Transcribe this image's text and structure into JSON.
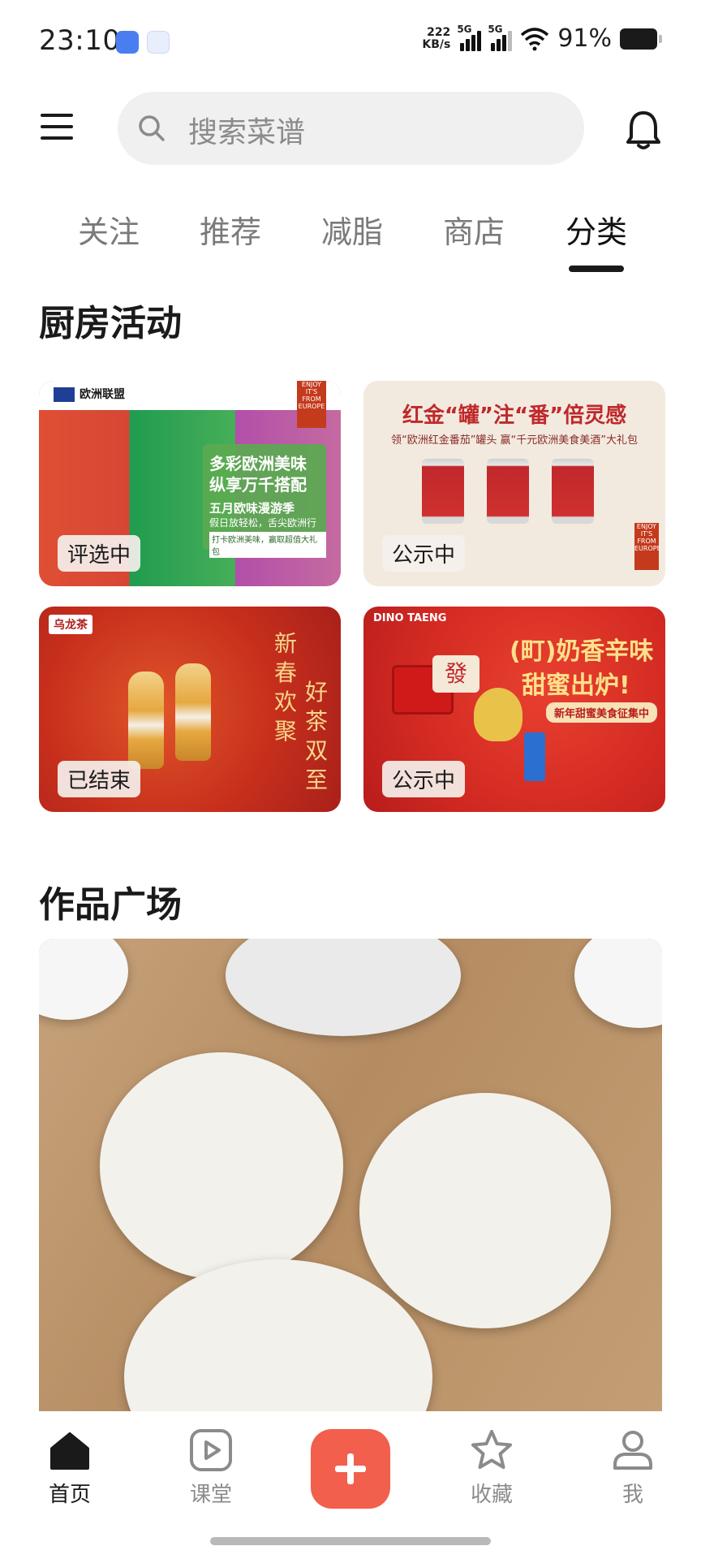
{
  "status_bar": {
    "time": "23:10",
    "speed_value": "222",
    "speed_unit": "KB/s",
    "network_1": "5G",
    "network_2": "5G",
    "battery": "91%"
  },
  "header": {
    "search_placeholder": "搜索菜谱"
  },
  "tabs": [
    {
      "label": "关注"
    },
    {
      "label": "推荐"
    },
    {
      "label": "减脂"
    },
    {
      "label": "商店"
    },
    {
      "label": "分类",
      "active": true
    }
  ],
  "kitchen_activities": {
    "title": "厨房活动",
    "cards": [
      {
        "status": "评选中",
        "brand": "欧洲联盟",
        "line1": "多彩欧洲美味",
        "line2": "纵享万千搭配",
        "line3": "五月欧味漫游季",
        "line4": "假日放轻松，舌尖欧洲行",
        "line5": "打卡欧洲美味，赢取超值大礼包",
        "badge": "ENJOY IT'S FROM EUROPE"
      },
      {
        "status": "公示中",
        "headline": "红金“罐”注“番”倍灵感",
        "sub": "领“欧洲红金番茄”罐头 赢“千元欧洲美食美酒”大礼包",
        "badge": "ENJOY IT'S FROM EUROPE"
      },
      {
        "status": "已结束",
        "brand": "乌龙茶",
        "slogan1": "新春欢聚",
        "slogan2": "好茶双至"
      },
      {
        "status": "公示中",
        "brand": "DINO TAENG",
        "title1": "(町)奶香辛味",
        "title2": "甜蜜出炉!",
        "pill": "新年甜蜜美食征集中",
        "box_char": "發"
      }
    ]
  },
  "works_square": {
    "title": "作品广场"
  },
  "bottom_nav": {
    "items": [
      {
        "label": "首页",
        "icon": "home-icon",
        "active": true
      },
      {
        "label": "课堂",
        "icon": "play-icon"
      },
      {
        "label": "收藏",
        "icon": "star-icon"
      },
      {
        "label": "我",
        "icon": "user-icon"
      }
    ],
    "fab_icon": "plus-icon"
  },
  "colors": {
    "accent": "#f25f4c",
    "text_primary": "#1a1a1a",
    "text_secondary": "#7a7a7a"
  }
}
